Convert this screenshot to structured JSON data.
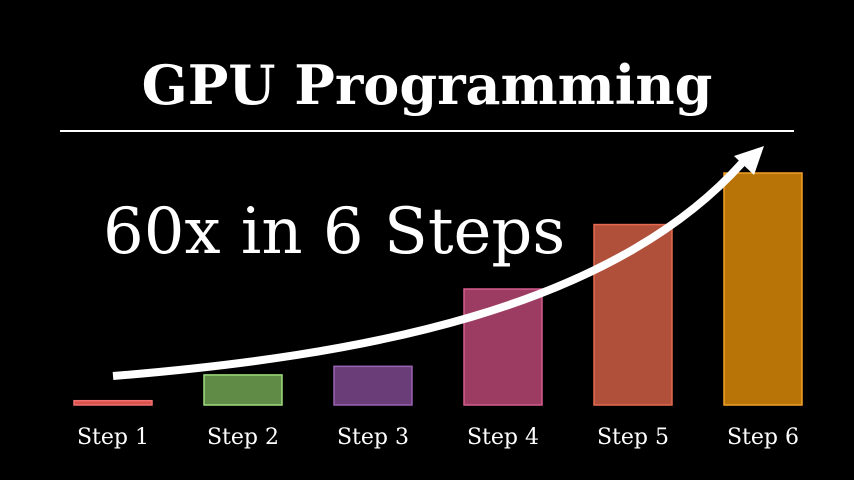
{
  "title": "GPU Programming",
  "headline": "60x in 6 Steps",
  "chart_data": {
    "type": "bar",
    "categories": [
      "Step 1",
      "Step 2",
      "Step 3",
      "Step 4",
      "Step 5",
      "Step 6"
    ],
    "values": [
      1,
      7,
      9,
      27,
      42,
      54
    ],
    "ylim": [
      0,
      54
    ],
    "colors": [
      "#d9524c",
      "#5f8b47",
      "#6a3d78",
      "#9c3c62",
      "#b04f3a",
      "#b87406"
    ],
    "strokes": [
      "#f07070",
      "#9fdc7e",
      "#9b63b3",
      "#d65c8f",
      "#e66a50",
      "#f2a12a"
    ],
    "grid": false,
    "legend": "none",
    "annotation": "upward-trend-arrow"
  }
}
